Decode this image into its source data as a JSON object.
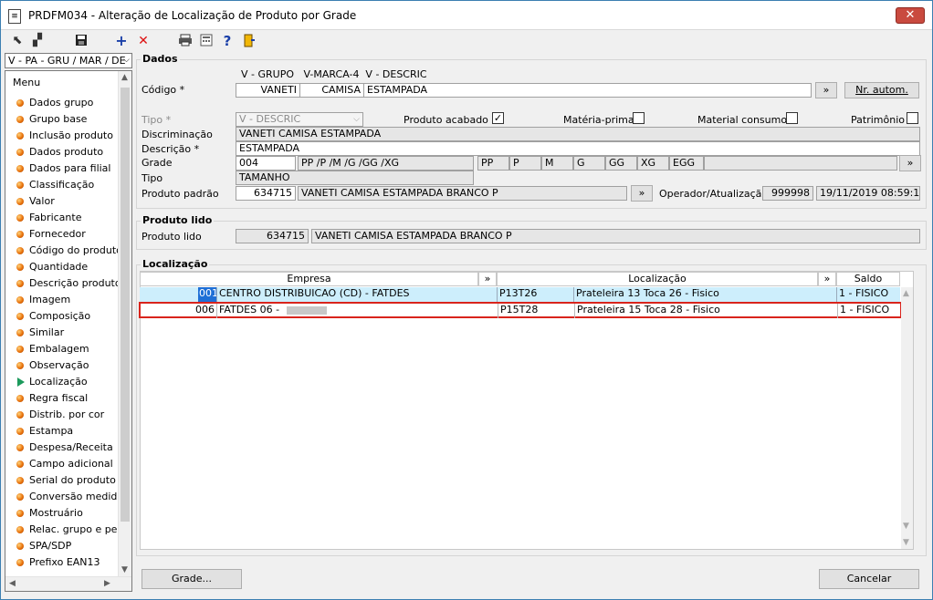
{
  "window": {
    "title": "PRDFM034 - Alteração de Localização de Produto por Grade",
    "close_label": "✕"
  },
  "toolbar": {
    "tools": [
      "tool-1-icon",
      "tool-2-icon",
      "save-icon",
      "add-icon",
      "delete-icon",
      "print-icon",
      "calc-icon",
      "help-icon",
      "exit-icon"
    ]
  },
  "left": {
    "combo": "V - PA - GRU / MAR / DE",
    "menu_header": "Menu",
    "items": [
      "Dados grupo",
      "Grupo base",
      "Inclusão produto",
      "Dados produto",
      "Dados para filial",
      "Classificação",
      "Valor",
      "Fabricante",
      "Fornecedor",
      "Código do produto",
      "Quantidade",
      "Descrição produto",
      "Imagem",
      "Composição",
      "Similar",
      "Embalagem",
      "Observação",
      "Localização",
      "Regra fiscal",
      "Distrib. por cor",
      "Estampa",
      "Despesa/Receita",
      "Campo adicional",
      "Serial do produto",
      "Conversão medida",
      "Mostruário",
      "Relac. grupo e pess",
      "SPA/SDP",
      "Prefixo EAN13"
    ]
  },
  "dados": {
    "title": "Dados",
    "codigo_label": "Código *",
    "col_headers": [
      "V - GRUPO",
      "V-MARCA-4",
      "V - DESCRIC"
    ],
    "codigo_values": [
      "VANETI",
      "CAMISA",
      "ESTAMPADA"
    ],
    "nr_autom": "Nr. autom.",
    "more_btn": "»",
    "tipo_label": "Tipo *",
    "tipo_value": "V - DESCRIC",
    "produto_acabado_label": "Produto acabado",
    "produto_acabado_checked": "✓",
    "materia_prima_label": "Matéria-prima",
    "material_consumo_label": "Material consumo",
    "patrimonio_label": "Patrimônio",
    "discriminacao_label": "Discriminação",
    "discriminacao_value": "VANETI CAMISA ESTAMPADA",
    "descricao_label": "Descrição *",
    "descricao_value": "ESTAMPADA",
    "grade_label": "Grade",
    "grade_code": "004",
    "grade_desc": "PP /P /M /G /GG /XG",
    "grade_sizes": [
      "PP",
      "P",
      "M",
      "G",
      "GG",
      "XG",
      "EGG"
    ],
    "tipo2_label": "Tipo",
    "tipo2_value": "TAMANHO",
    "produto_padrao_label": "Produto padrão",
    "produto_padrao_code": "634715",
    "produto_padrao_desc": "VANETI CAMISA ESTAMPADA BRANCO P",
    "operador_label": "Operador/Atualização",
    "operador_value": "999998",
    "atualizacao_value": "19/11/2019 08:59:10"
  },
  "produto_lido": {
    "title": "Produto lido",
    "label": "Produto lido",
    "code": "634715",
    "desc": "VANETI CAMISA ESTAMPADA BRANCO P"
  },
  "localizacao": {
    "title": "Localização",
    "headers": [
      "Empresa",
      "»",
      "Localização",
      "»",
      "Saldo"
    ],
    "rows": [
      {
        "code": "001",
        "empresa": "CENTRO DISTRIBUICAO (CD) - FATDES",
        "loc_code": "P13T26",
        "loc_desc": "Prateleira 13 Toca 26 - Fisico",
        "saldo": "1 - FISICO"
      },
      {
        "code": "006",
        "empresa": "FATDES 06 -",
        "loc_code": "P15T28",
        "loc_desc": "Prateleira 15 Toca 28 - Fisico",
        "saldo": "1 - FISICO"
      }
    ]
  },
  "footer": {
    "grade_btn": "Grade...",
    "cancel_btn": "Cancelar"
  },
  "colors": {
    "selected_row": "#cdeefc",
    "highlight_border": "#d9241c",
    "title_close": "#c94a3f"
  }
}
